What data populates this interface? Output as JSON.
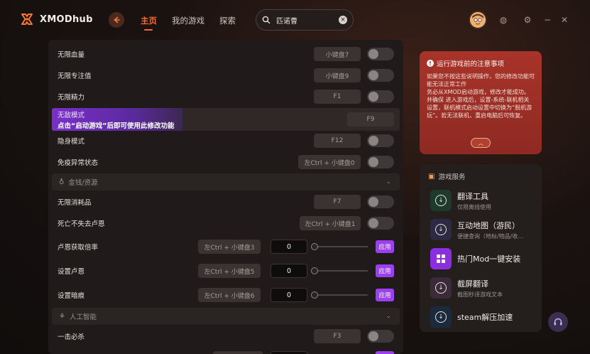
{
  "app": {
    "name": "XMODhub"
  },
  "nav": {
    "home": "主页",
    "my_games": "我的游戏",
    "explore": "探索"
  },
  "search": {
    "value": "匹诺曹"
  },
  "colors": {
    "accent": "#ff6a2a",
    "purple": "#9b3ff0",
    "notice_bg": "#a8332a"
  },
  "cheats": [
    {
      "label": "无限血量",
      "key": "小键盘7",
      "on": false
    },
    {
      "label": "无限专注值",
      "key": "小键盘9",
      "on": false
    },
    {
      "label": "无限精力",
      "key": "F1",
      "on": false
    },
    {
      "label": "无敌模式",
      "warning": "点击“启动游戏”后即可使用此修改功能",
      "key": "F9"
    },
    {
      "label": "隐身模式",
      "key": "F12",
      "on": false
    },
    {
      "label": "免疫异常状态",
      "key": "左Ctrl + 小键盘0",
      "on": false
    }
  ],
  "sections": {
    "money": "金钱/资源",
    "ai": "人工智能"
  },
  "money_items": [
    {
      "label": "无限消耗品",
      "key": "F7",
      "on": false
    },
    {
      "label": "死亡不失去卢恩",
      "key": "左Ctrl + 小键盘1",
      "on": false
    }
  ],
  "value_items": [
    {
      "label": "卢恩获取倍率",
      "key": "左Ctrl + 小键盘3",
      "value": "0",
      "apply": "应用"
    },
    {
      "label": "设置卢恩",
      "key": "左Ctrl + 小键盘5",
      "value": "0",
      "apply": "应用"
    },
    {
      "label": "设置暗痕",
      "key": "左Ctrl + 小键盘6",
      "value": "0",
      "apply": "应用"
    }
  ],
  "ai_items": [
    {
      "label": "一击必杀",
      "key": "F3",
      "on": false
    }
  ],
  "notice": {
    "title": "运行游戏前的注意事项",
    "body": "如果您不按这些说明操作，您的修改功能可能无法正常工作\n务必从XMOD启动游戏，修改才能成功。\n并确保 进入游戏后，设置-系统-联机相关设置，联机模式启动设置中切换为“脱机游玩”。若无法联机，重启电脑后可恢复。"
  },
  "services": {
    "title": "游戏服务",
    "items": [
      {
        "name": "翻译工具",
        "desc": "仅限离线使用"
      },
      {
        "name": "互动地图（游民）",
        "desc": "便捷查询（地标/物品/收..."
      },
      {
        "name": "热门Mod一键安装",
        "desc": ""
      },
      {
        "name": "截屏翻译",
        "desc": "截图秒译游戏文本"
      },
      {
        "name": "steam解压加速",
        "desc": ""
      }
    ]
  }
}
